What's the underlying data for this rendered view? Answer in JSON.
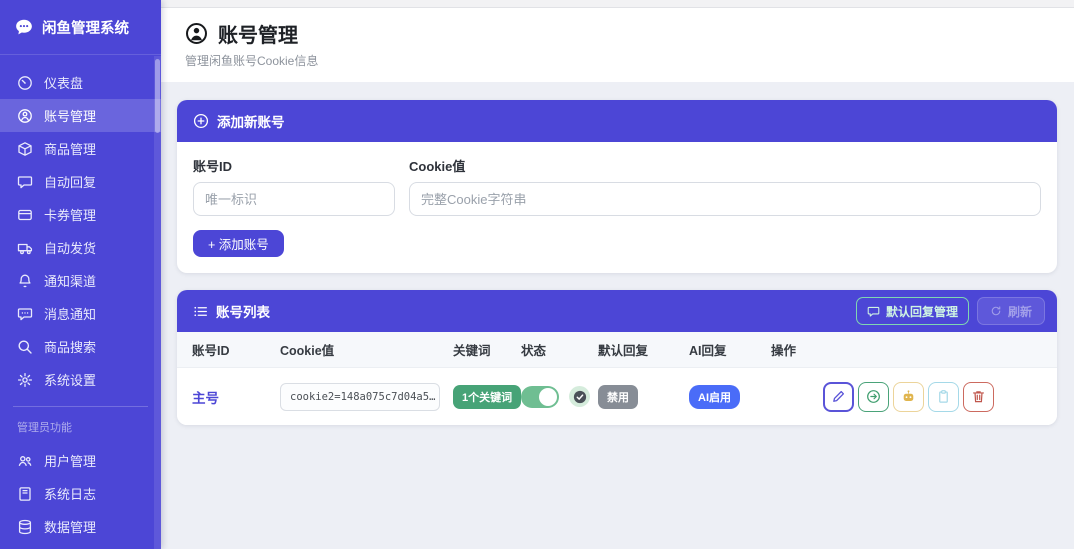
{
  "app": {
    "title": "闲鱼管理系统"
  },
  "sidebar": {
    "items": [
      {
        "label": "仪表盘",
        "icon": "gauge-icon"
      },
      {
        "label": "账号管理",
        "icon": "person-icon",
        "active": true
      },
      {
        "label": "商品管理",
        "icon": "box-icon"
      },
      {
        "label": "自动回复",
        "icon": "chat-icon"
      },
      {
        "label": "卡券管理",
        "icon": "credit-card-icon"
      },
      {
        "label": "自动发货",
        "icon": "truck-icon"
      },
      {
        "label": "通知渠道",
        "icon": "bell-icon"
      },
      {
        "label": "消息通知",
        "icon": "chat-dots-icon"
      },
      {
        "label": "商品搜索",
        "icon": "search-icon"
      },
      {
        "label": "系统设置",
        "icon": "gear-icon"
      }
    ],
    "section_label": "管理员功能",
    "admin_items": [
      {
        "label": "用户管理",
        "icon": "people-icon"
      },
      {
        "label": "系统日志",
        "icon": "journal-icon"
      },
      {
        "label": "数据管理",
        "icon": "database-icon"
      }
    ]
  },
  "header": {
    "title": "账号管理",
    "subtitle": "管理闲鱼账号Cookie信息"
  },
  "add_card": {
    "title": "添加新账号",
    "account_id_label": "账号ID",
    "account_id_placeholder": "唯一标识",
    "cookie_label": "Cookie值",
    "cookie_placeholder": "完整Cookie字符串",
    "submit_label": "+ 添加账号"
  },
  "list_card": {
    "title": "账号列表",
    "default_reply_btn": "默认回复管理",
    "refresh_btn": "刷新",
    "headers": [
      "账号ID",
      "Cookie值",
      "关键词",
      "状态",
      "默认回复",
      "AI回复",
      "操作"
    ],
    "row": {
      "account_id": "主号",
      "cookie": "cookie2=148a075c7d04a5…",
      "keyword_badge": "1个关键词",
      "status_on": true,
      "default_reply_badge": "禁用",
      "ai_reply_badge": "AI启用"
    }
  },
  "colors": {
    "accent": "#4c46d6",
    "keyword_badge_green": "#47a377",
    "toggle_green": "#6fbe92",
    "ai_badge_blue": "#4a6cf8",
    "disabled_badge_gray": "#878d96",
    "edit_purple": "#5a54d8",
    "enter_green": "#3f9e6e",
    "robot_yellow": "#e0b54e",
    "copy_cyan": "#a5d9e8",
    "delete_red": "#c0564c"
  }
}
